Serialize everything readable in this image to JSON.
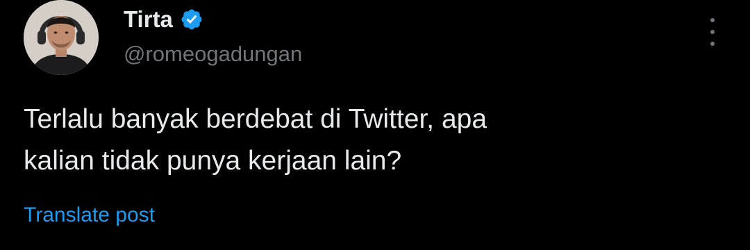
{
  "author": {
    "name": "Tirta",
    "handle": "@romeogadungan",
    "verified_icon": "verified-badge-icon",
    "verified_color": "#1d9bf0"
  },
  "post": {
    "text_lines": [
      "Terlalu banyak berdebat di Twitter, apa",
      "kalian tidak punya kerjaan lain?"
    ]
  },
  "actions": {
    "translate_label": "Translate post",
    "more_icon": "more-options-icon"
  },
  "colors": {
    "background": "#000000",
    "primary_text": "#e7e9ea",
    "secondary_text": "#71767b",
    "link": "#1d9bf0"
  }
}
